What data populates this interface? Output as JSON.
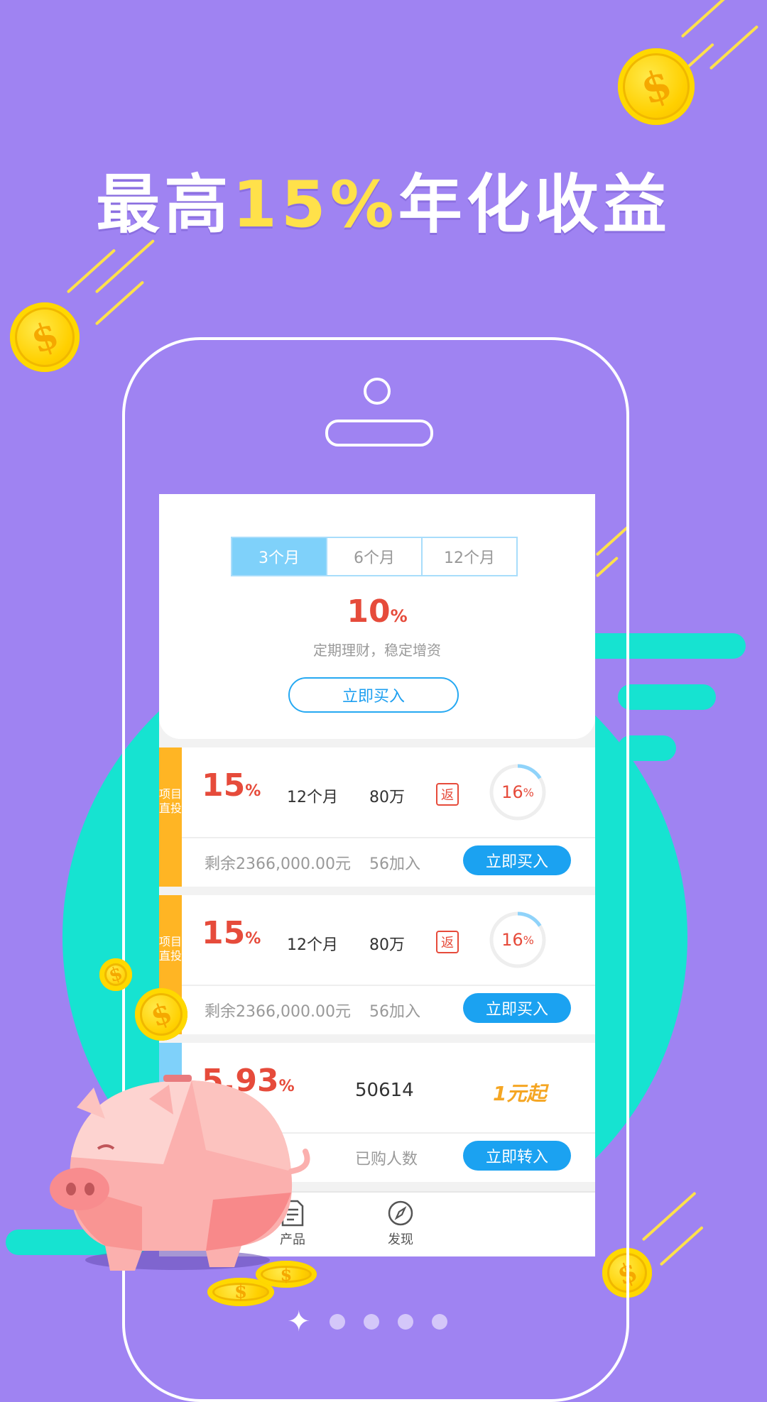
{
  "headline": {
    "prefix": "最高",
    "highlight": "15%",
    "suffix": "年化收益"
  },
  "tabs": [
    {
      "label": "3个月",
      "active": true
    },
    {
      "label": "6个月",
      "active": false
    },
    {
      "label": "12个月",
      "active": false
    }
  ],
  "featured": {
    "rate_value": "10",
    "rate_unit": "%",
    "description": "定期理财，稳定增资",
    "buy_label": "立即买入"
  },
  "products": [
    {
      "side_label": "项目直投",
      "rate_value": "15",
      "rate_unit": "%",
      "term": "12个月",
      "amount": "80万",
      "rebate": "返",
      "progress_value": "16",
      "progress_unit": "%",
      "progress_fraction": 0.16,
      "remaining": "剩余2366,000.00元",
      "joined": "56加入",
      "buy_label": "立即买入"
    },
    {
      "side_label": "项目直投",
      "rate_value": "15",
      "rate_unit": "%",
      "term": "12个月",
      "amount": "80万",
      "rebate": "返",
      "progress_value": "16",
      "progress_unit": "%",
      "progress_fraction": 0.16,
      "remaining": "剩余2366,000.00元",
      "joined": "56加入",
      "buy_label": "立即买入"
    }
  ],
  "fund": {
    "rate_value": "5.93",
    "rate_unit": "%",
    "count": "50614",
    "min_label": "1元起",
    "buyers_label": "已购人数",
    "transfer_label": "立即转入"
  },
  "nav": {
    "products_label": "产品",
    "discover_label": "发现"
  },
  "colors": {
    "background": "#9f83f2",
    "accent_yellow": "#ffe14a",
    "teal": "#16e3d1",
    "rate_red": "#e64b3b",
    "button_blue": "#1ba2f1",
    "tag_orange": "#ffb524"
  },
  "pager": {
    "total_pages": 5,
    "current_page": 1
  }
}
